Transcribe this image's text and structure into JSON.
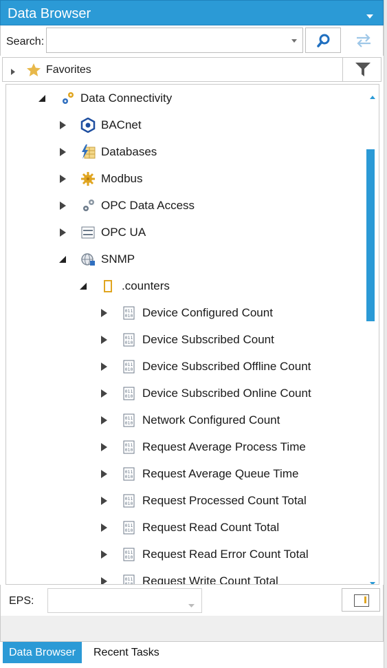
{
  "window": {
    "title": "Data Browser"
  },
  "search": {
    "label": "Search:",
    "value": "",
    "placeholder": ""
  },
  "favorites": {
    "label": "Favorites"
  },
  "tree": {
    "root": {
      "label": "Data Connectivity",
      "icon": "gears-icon"
    },
    "children": [
      {
        "label": "BACnet",
        "icon": "bacnet-icon"
      },
      {
        "label": "Databases",
        "icon": "database-icon"
      },
      {
        "label": "Modbus",
        "icon": "modbus-icon"
      },
      {
        "label": "OPC Data Access",
        "icon": "gears-icon"
      },
      {
        "label": "OPC UA",
        "icon": "opc-ua-icon"
      },
      {
        "label": "SNMP",
        "icon": "snmp-icon"
      }
    ],
    "folder": {
      "label": ".counters",
      "icon": "folder-icon"
    },
    "counters": [
      "Device Configured Count",
      "Device Subscribed Count",
      "Device Subscribed Offline Count",
      "Device Subscribed Online Count",
      "Network Configured Count",
      "Request Average Process Time",
      "Request Average Queue Time",
      "Request Processed Count Total",
      "Request Read Count Total",
      "Request Read Error Count Total",
      "Request Write Count Total"
    ]
  },
  "eps": {
    "label": "EPS:",
    "value": ""
  },
  "tabs": [
    {
      "label": "Data Browser",
      "active": true
    },
    {
      "label": "Recent Tasks",
      "active": false
    }
  ],
  "colors": {
    "accent": "#2b9ad6",
    "icon_blue": "#2f6fbf",
    "icon_gold": "#e0a520"
  }
}
